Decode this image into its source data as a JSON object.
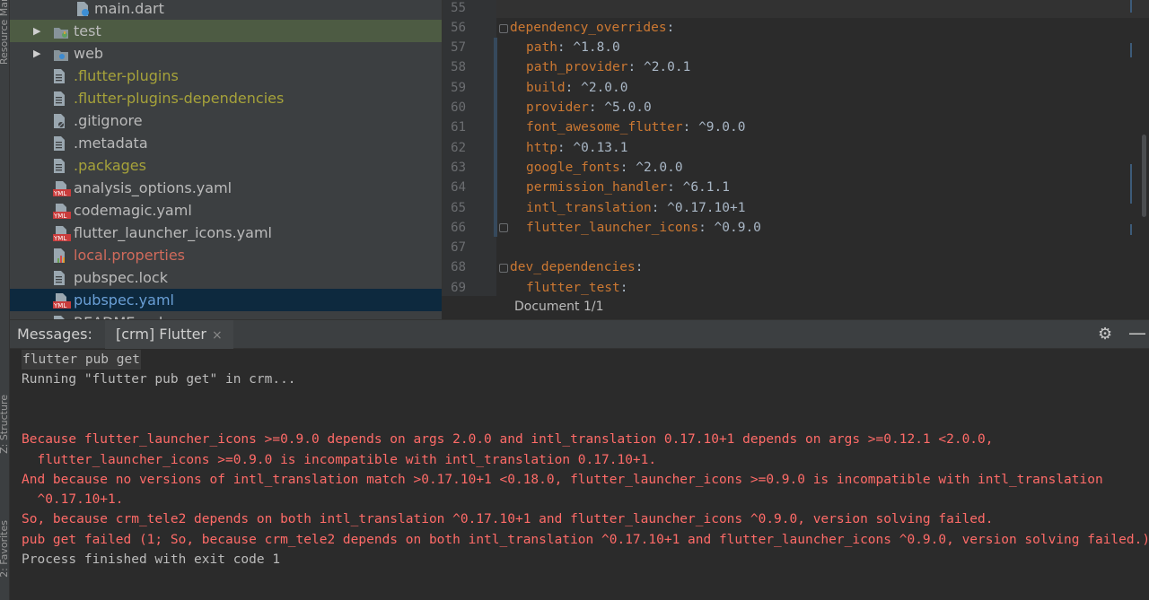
{
  "left_strip": {
    "tab_top": "Resource Manager",
    "tab_mid": "Z: Structure",
    "tab_bottom": "2: Favorites"
  },
  "tree": {
    "items": [
      {
        "name": "main.dart",
        "icon": "dart-file-icon",
        "color": "def",
        "indent": 2
      },
      {
        "name": "test",
        "icon": "test-folder-icon",
        "color": "def",
        "indent": 0,
        "arrow": "▶",
        "hl": "green"
      },
      {
        "name": "web",
        "icon": "web-folder-icon",
        "color": "def",
        "indent": 0,
        "arrow": "▶"
      },
      {
        "name": ".flutter-plugins",
        "icon": "file-icon",
        "color": "olive",
        "indent": 1
      },
      {
        "name": ".flutter-plugins-dependencies",
        "icon": "file-icon",
        "color": "olive",
        "indent": 1
      },
      {
        "name": ".gitignore",
        "icon": "ignore-file-icon",
        "color": "def",
        "indent": 1
      },
      {
        "name": ".metadata",
        "icon": "file-icon",
        "color": "def",
        "indent": 1
      },
      {
        "name": ".packages",
        "icon": "file-icon",
        "color": "olive",
        "indent": 1
      },
      {
        "name": "analysis_options.yaml",
        "icon": "yaml-file-icon",
        "color": "def",
        "indent": 1
      },
      {
        "name": "codemagic.yaml",
        "icon": "yaml-file-icon",
        "color": "def",
        "indent": 1
      },
      {
        "name": "flutter_launcher_icons.yaml",
        "icon": "yaml-file-icon",
        "color": "def",
        "indent": 1
      },
      {
        "name": "local.properties",
        "icon": "properties-file-icon",
        "color": "red",
        "indent": 1
      },
      {
        "name": "pubspec.lock",
        "icon": "file-icon",
        "color": "def",
        "indent": 1
      },
      {
        "name": "pubspec.yaml",
        "icon": "yaml-file-icon",
        "color": "blue",
        "indent": 1,
        "selected": true
      },
      {
        "name": "README.md",
        "icon": "markdown-file-icon",
        "color": "def",
        "indent": 1
      }
    ]
  },
  "editor": {
    "lines": [
      {
        "num": "55",
        "key": "",
        "val": ""
      },
      {
        "num": "56",
        "key": "dependency_overrides",
        "val": ":",
        "indent": 0
      },
      {
        "num": "57",
        "key": "path",
        "val": ": ^1.8.0",
        "indent": 1
      },
      {
        "num": "58",
        "key": "path_provider",
        "val": ": ^2.0.1",
        "indent": 1
      },
      {
        "num": "59",
        "key": "build",
        "val": ": ^2.0.0",
        "indent": 1
      },
      {
        "num": "60",
        "key": "provider",
        "val": ": ^5.0.0",
        "indent": 1
      },
      {
        "num": "61",
        "key": "font_awesome_flutter",
        "val": ": ^9.0.0",
        "indent": 1
      },
      {
        "num": "62",
        "key": "http",
        "val": ": ^0.13.1",
        "indent": 1
      },
      {
        "num": "63",
        "key": "google_fonts",
        "val": ": ^2.0.0",
        "indent": 1
      },
      {
        "num": "64",
        "key": "permission_handler",
        "val": ": ^6.1.1",
        "indent": 1
      },
      {
        "num": "65",
        "key": "intl_translation",
        "val": ": ^0.17.10+1",
        "indent": 1
      },
      {
        "num": "66",
        "key": "flutter_launcher_icons",
        "val": ": ^0.9.0",
        "indent": 1
      },
      {
        "num": "67",
        "key": "",
        "val": ""
      },
      {
        "num": "68",
        "key": "dev_dependencies",
        "val": ":",
        "indent": 0
      },
      {
        "num": "69",
        "key": "flutter_test",
        "val": ":",
        "indent": 1
      }
    ],
    "status": "Document 1/1"
  },
  "panel": {
    "title": "Messages:",
    "tab_label": "[crm] Flutter",
    "close_glyph": "×",
    "gear_glyph": "⚙",
    "minimize_glyph": "—"
  },
  "console": {
    "lines": [
      {
        "text": "flutter pub get",
        "kind": "cmd"
      },
      {
        "text": "Running \"flutter pub get\" in crm...",
        "kind": "normal"
      },
      {
        "text": "",
        "kind": "normal"
      },
      {
        "text": "",
        "kind": "normal"
      },
      {
        "text": "Because flutter_launcher_icons >=0.9.0 depends on args 2.0.0 and intl_translation 0.17.10+1 depends on args >=0.12.1 <2.0.0,",
        "kind": "err"
      },
      {
        "text": "  flutter_launcher_icons >=0.9.0 is incompatible with intl_translation 0.17.10+1.",
        "kind": "err"
      },
      {
        "text": "And because no versions of intl_translation match >0.17.10+1 <0.18.0, flutter_launcher_icons >=0.9.0 is incompatible with intl_translation",
        "kind": "err"
      },
      {
        "text": "  ^0.17.10+1.",
        "kind": "err"
      },
      {
        "text": "So, because crm_tele2 depends on both intl_translation ^0.17.10+1 and flutter_launcher_icons ^0.9.0, version solving failed.",
        "kind": "err"
      },
      {
        "text": "pub get failed (1; So, because crm_tele2 depends on both intl_translation ^0.17.10+1 and flutter_launcher_icons ^0.9.0, version solving failed.)",
        "kind": "err"
      },
      {
        "text": "Process finished with exit code 1",
        "kind": "normal"
      }
    ]
  }
}
